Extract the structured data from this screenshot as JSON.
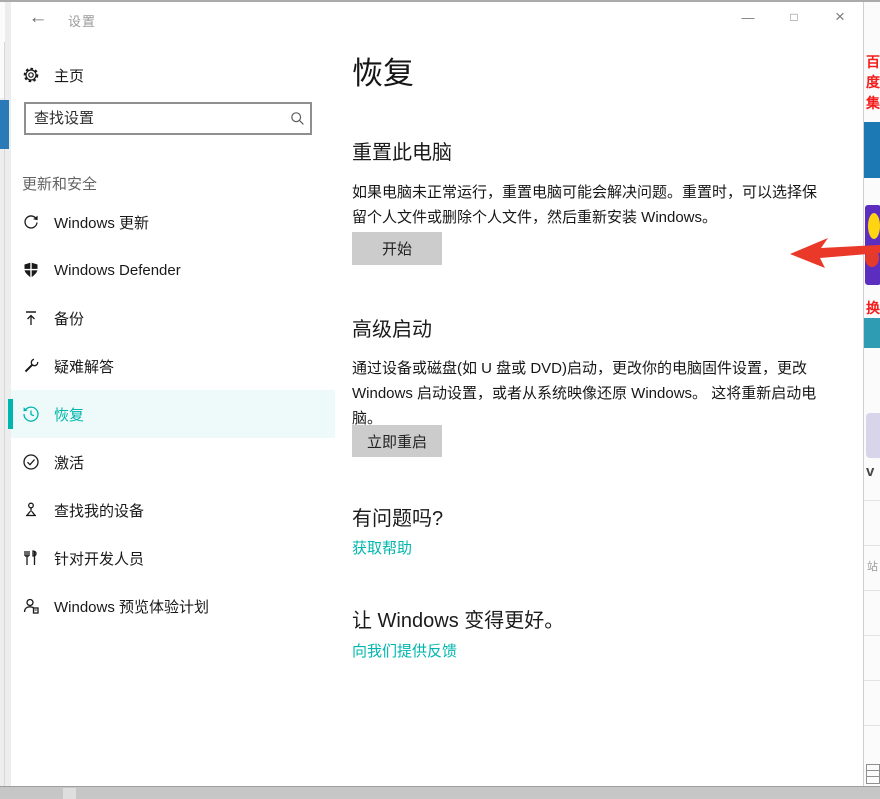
{
  "titlebar": {
    "back_glyph": "←",
    "title": "设置",
    "minimize_glyph": "—",
    "maximize_glyph": "□",
    "close_glyph": "×"
  },
  "sidebar": {
    "home_label": "主页",
    "search_placeholder": "查找设置",
    "section_label": "更新和安全",
    "items": [
      {
        "label": "Windows 更新",
        "icon": "sync-icon",
        "selected": false
      },
      {
        "label": "Windows Defender",
        "icon": "shield-icon",
        "selected": false
      },
      {
        "label": "备份",
        "icon": "backup-icon",
        "selected": false
      },
      {
        "label": "疑难解答",
        "icon": "wrench-icon",
        "selected": false
      },
      {
        "label": "恢复",
        "icon": "history-icon",
        "selected": true
      },
      {
        "label": "激活",
        "icon": "check-circle-icon",
        "selected": false
      },
      {
        "label": "查找我的设备",
        "icon": "locate-device-icon",
        "selected": false
      },
      {
        "label": "针对开发人员",
        "icon": "developer-icon",
        "selected": false
      },
      {
        "label": "Windows 预览体验计划",
        "icon": "insider-icon",
        "selected": false
      }
    ]
  },
  "main": {
    "page_title": "恢复",
    "reset_pc": {
      "heading": "重置此电脑",
      "body": "如果电脑未正常运行，重置电脑可能会解决问题。重置时，可以选择保留个人文件或删除个人文件，然后重新安装 Windows。",
      "button_label": "开始"
    },
    "advanced_startup": {
      "heading": "高级启动",
      "body": "通过设备或磁盘(如 U 盘或 DVD)启动，更改你的电脑固件设置，更改 Windows 启动设置，或者从系统映像还原 Windows。 这将重新启动电脑。",
      "button_label": "立即重启"
    },
    "question": {
      "heading": "有问题吗?",
      "link_label": "获取帮助"
    },
    "feedback": {
      "heading": "让 Windows 变得更好。",
      "link_label": "向我们提供反馈"
    }
  },
  "background_edges": {
    "right_fragments": [
      "百",
      "度",
      "集",
      "换"
    ],
    "v_fragment": "v",
    "gray_fragment": "站"
  },
  "colors": {
    "accent_teal": "#00b5ad",
    "annotation_arrow_red": "#ea3829",
    "edge_blue": "#1d79b4",
    "edge_purple": "#5b2ec0",
    "edge_yellow": "#ffd411"
  }
}
